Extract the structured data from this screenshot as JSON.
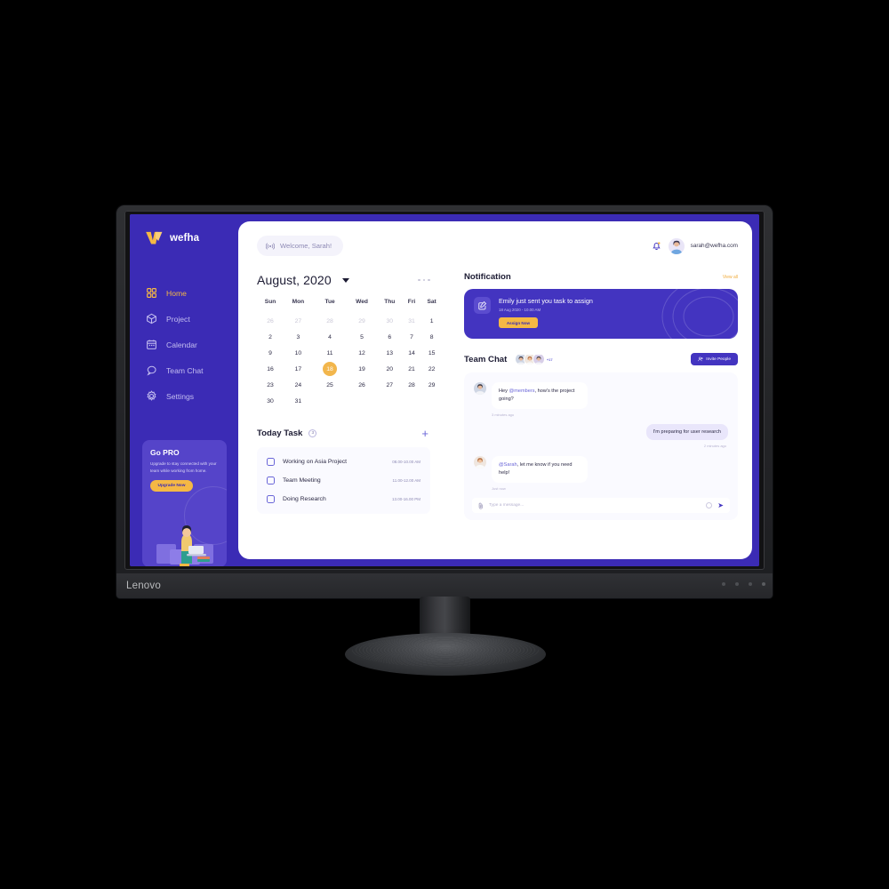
{
  "monitor": {
    "brand": "Lenovo"
  },
  "app": {
    "logo_text": "wefha",
    "accent_purple": "#3b2bb5",
    "accent_yellow": "#f5b844",
    "sidebar": {
      "items": [
        {
          "label": "Home",
          "icon": "grid-icon",
          "active": true
        },
        {
          "label": "Project",
          "icon": "cube-icon",
          "active": false
        },
        {
          "label": "Calendar",
          "icon": "calendar-icon",
          "active": false
        },
        {
          "label": "Team Chat",
          "icon": "chat-icon",
          "active": false
        },
        {
          "label": "Settings",
          "icon": "gear-icon",
          "active": false
        }
      ],
      "promo": {
        "title": "Go PRO",
        "body": "Upgrade to stay connected with your team while working from home.",
        "button": "Upgrade Now"
      }
    },
    "header": {
      "welcome": "Welcome, Sarah!",
      "welcome_icon": "broadcast-icon",
      "bell_icon": "bell-icon",
      "email": "sarah@wefha.com"
    },
    "calendar": {
      "title": "August, 2020",
      "weekdays": [
        "Sun",
        "Mon",
        "Tue",
        "Wed",
        "Thu",
        "Fri",
        "Sat"
      ],
      "selected_day": 18,
      "weeks": [
        [
          {
            "d": "26",
            "mut": true
          },
          {
            "d": "27",
            "mut": true
          },
          {
            "d": "28",
            "mut": true
          },
          {
            "d": "29",
            "mut": true
          },
          {
            "d": "30",
            "mut": true
          },
          {
            "d": "31",
            "mut": true
          },
          {
            "d": "1",
            "mut": false
          }
        ],
        [
          {
            "d": "2",
            "mut": false
          },
          {
            "d": "3",
            "mut": false
          },
          {
            "d": "4",
            "mut": false
          },
          {
            "d": "5",
            "mut": false
          },
          {
            "d": "6",
            "mut": false
          },
          {
            "d": "7",
            "mut": false
          },
          {
            "d": "8",
            "mut": false
          }
        ],
        [
          {
            "d": "9",
            "mut": false
          },
          {
            "d": "10",
            "mut": false
          },
          {
            "d": "11",
            "mut": false
          },
          {
            "d": "12",
            "mut": false
          },
          {
            "d": "13",
            "mut": false
          },
          {
            "d": "14",
            "mut": false
          },
          {
            "d": "15",
            "mut": false
          }
        ],
        [
          {
            "d": "16",
            "mut": false
          },
          {
            "d": "17",
            "mut": false
          },
          {
            "d": "18",
            "mut": false,
            "sel": true
          },
          {
            "d": "19",
            "mut": false
          },
          {
            "d": "20",
            "mut": false
          },
          {
            "d": "21",
            "mut": false
          },
          {
            "d": "22",
            "mut": false
          }
        ],
        [
          {
            "d": "23",
            "mut": false
          },
          {
            "d": "24",
            "mut": false
          },
          {
            "d": "25",
            "mut": false
          },
          {
            "d": "26",
            "mut": false
          },
          {
            "d": "27",
            "mut": false
          },
          {
            "d": "28",
            "mut": false
          },
          {
            "d": "29",
            "mut": false
          }
        ],
        [
          {
            "d": "30",
            "mut": false
          },
          {
            "d": "31",
            "mut": false
          },
          {
            "d": "",
            "mut": false
          },
          {
            "d": "",
            "mut": false
          },
          {
            "d": "",
            "mut": false
          },
          {
            "d": "",
            "mut": false
          },
          {
            "d": "",
            "mut": false
          }
        ]
      ]
    },
    "tasks": {
      "title": "Today Task",
      "count": "3",
      "add_label": "+",
      "items": [
        {
          "name": "Working on Asia Project",
          "time": "08.00-10.00 AM"
        },
        {
          "name": "Team Meeting",
          "time": "11.00-12.00 AM"
        },
        {
          "name": "Doing Research",
          "time": "13.00-16.00 PM"
        }
      ]
    },
    "notification": {
      "title": "Notification",
      "view_all": "View all",
      "card": {
        "icon": "edit-square-icon",
        "message": "Emily just sent you task to assign",
        "timestamp": "18 Aug 2020 - 10.00 AM",
        "button": "Assign Now"
      }
    },
    "team_chat": {
      "title": "Team Chat",
      "overflow_count": "+17",
      "invite_button": "Invite People",
      "invite_icon": "person-add-icon",
      "messages": [
        {
          "side": "left",
          "mention": "@members",
          "before": "Hey ",
          "after": ", how's the project going?",
          "stamp": "3 minutes ago"
        },
        {
          "side": "right",
          "text": "I'm preparing for user research",
          "stamp": "2 minutes ago"
        },
        {
          "side": "left",
          "mention": "@Sarah",
          "before": "",
          "after": ", let me know if you need help!",
          "stamp": "Just now"
        }
      ],
      "composer": {
        "placeholder": "Type a message...",
        "attach_icon": "paperclip-icon",
        "emoji_icon": "emoji-icon",
        "send_icon": "send-icon"
      }
    }
  }
}
